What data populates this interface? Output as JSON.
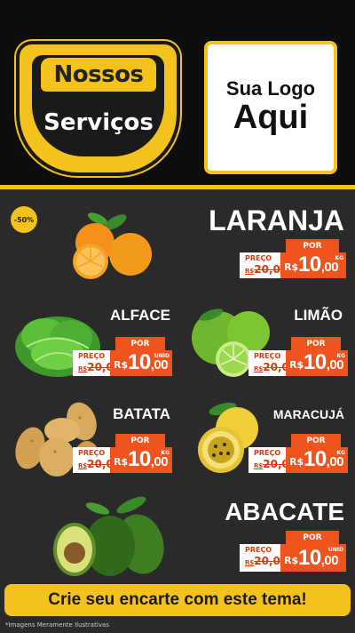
{
  "header": {
    "brand_top": "Nossos",
    "brand_bottom": "Serviços",
    "logo_line1": "Sua Logo",
    "logo_line2": "Aqui"
  },
  "discount_badge": "-50%",
  "products": [
    {
      "name": "LARANJA",
      "por": "POR",
      "preco": "PREÇO",
      "old_currency": "R$",
      "old_price": "20,00",
      "currency": "R$",
      "price_int": "10",
      "price_cents": ",00",
      "unit": "KG"
    },
    {
      "name": "ALFACE",
      "por": "POR",
      "preco": "PREÇO",
      "old_currency": "R$",
      "old_price": "20,00",
      "currency": "R$",
      "price_int": "10",
      "price_cents": ",00",
      "unit": "UNID"
    },
    {
      "name": "LIMÃO",
      "por": "POR",
      "preco": "PREÇO",
      "old_currency": "R$",
      "old_price": "20,00",
      "currency": "R$",
      "price_int": "10",
      "price_cents": ",00",
      "unit": "KG"
    },
    {
      "name": "BATATA",
      "por": "POR",
      "preco": "PREÇO",
      "old_currency": "R$",
      "old_price": "20,00",
      "currency": "R$",
      "price_int": "10",
      "price_cents": ",00",
      "unit": "KG"
    },
    {
      "name": "MARACUJÁ",
      "por": "POR",
      "preco": "PREÇO",
      "old_currency": "R$",
      "old_price": "20,00",
      "currency": "R$",
      "price_int": "10",
      "price_cents": ",00",
      "unit": "KG"
    },
    {
      "name": "ABACATE",
      "por": "POR",
      "preco": "PREÇO",
      "old_currency": "R$",
      "old_price": "20,00",
      "currency": "R$",
      "price_int": "10",
      "price_cents": ",00",
      "unit": "UNID"
    }
  ],
  "cta": "Crie seu encarte com este tema!",
  "footnote": "*Imagens Meramente Ilustrativas",
  "colors": {
    "accent": "#f4c21c",
    "price": "#f0541e",
    "background": "#2a2a2a",
    "header": "#0d0d0d"
  },
  "icons": [
    "orange-icon",
    "lettuce-icon",
    "lime-icon",
    "potato-icon",
    "passion-fruit-icon",
    "avocado-icon"
  ]
}
